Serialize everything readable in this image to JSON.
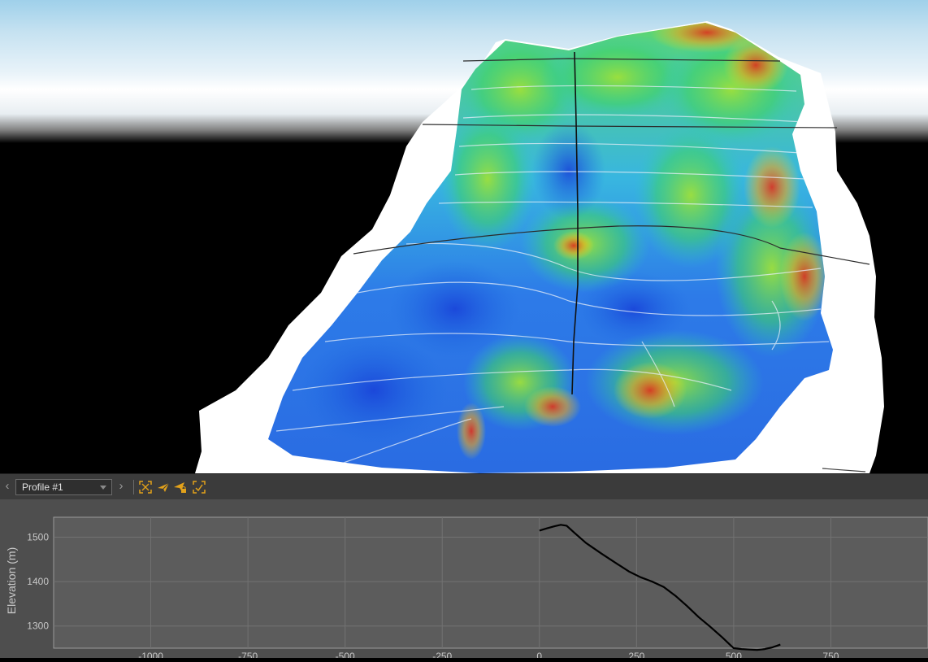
{
  "toolbar": {
    "prev_label": "‹",
    "next_label": "›",
    "profile_selected": "Profile #1",
    "buttons": [
      "zoom-extents-icon",
      "send-icon",
      "send-locked-icon",
      "fit-selection-icon"
    ],
    "accent_color": "#e3a21a"
  },
  "chart_data": {
    "type": "line",
    "ylabel": "Elevation (m)",
    "xlabel": "",
    "xlim": [
      -1250,
      1000
    ],
    "ylim": [
      1250,
      1545
    ],
    "x_ticks": [
      -1000,
      -750,
      -500,
      -250,
      0,
      250,
      500,
      750
    ],
    "x_tick_labels": [
      "-1000",
      "-750",
      "-500",
      "-250",
      "0",
      "250",
      "500",
      "750"
    ],
    "y_ticks": [
      1300,
      1400,
      1500
    ],
    "y_tick_labels": [
      "1300",
      "1400",
      "1500"
    ],
    "grid": true,
    "series": [
      {
        "color": "#000000",
        "x": [
          0,
          20,
          40,
          55,
          70,
          90,
          120,
          160,
          200,
          230,
          260,
          290,
          320,
          350,
          380,
          410,
          440,
          470,
          490,
          500,
          520,
          540,
          560,
          580,
          600,
          620
        ],
        "y": [
          1515,
          1520,
          1525,
          1528,
          1526,
          1510,
          1487,
          1463,
          1440,
          1423,
          1410,
          1400,
          1388,
          1368,
          1345,
          1320,
          1298,
          1275,
          1258,
          1250,
          1248,
          1247,
          1246,
          1248,
          1252,
          1258
        ]
      }
    ]
  }
}
